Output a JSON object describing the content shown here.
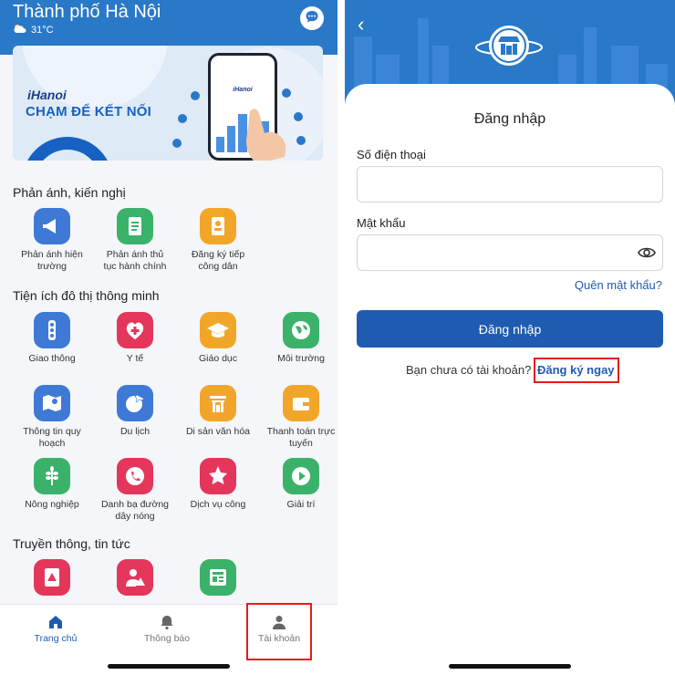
{
  "colors": {
    "brand_blue": "#2a78c8",
    "primary": "#1f5cb0",
    "highlight_red": "#e11d1d",
    "tile_blue": "#3f79d6",
    "tile_green": "#3bb26a",
    "tile_orange": "#f2a629",
    "tile_red": "#e4365b"
  },
  "left": {
    "header": {
      "city": "Thành phố Hà Nội",
      "temperature": "31°C",
      "weather_icon": "cloud-sun-icon",
      "chat_icon": "chat-icon"
    },
    "banner": {
      "brand": "iHanoi",
      "tagline": "CHẠM ĐỂ KẾT NỐI",
      "phone_brand": "iHanoi"
    },
    "sections": {
      "feedback": {
        "title": "Phản ánh, kiến nghị",
        "items": [
          {
            "label_1": "Phản ánh hiện",
            "label_2": "trường",
            "icon": "megaphone-icon",
            "color": "#3f79d6"
          },
          {
            "label_1": "Phản ánh thủ",
            "label_2": "tục hành chính",
            "icon": "document-icon",
            "color": "#3bb26a"
          },
          {
            "label_1": "Đăng ký tiếp",
            "label_2": "công dân",
            "icon": "register-icon",
            "color": "#f2a629"
          }
        ]
      },
      "smart_city": {
        "title": "Tiện ích đô thị thông minh",
        "items": [
          {
            "label_1": "Giao thông",
            "label_2": "",
            "icon": "traffic-light-icon",
            "color": "#3f79d6"
          },
          {
            "label_1": "Y tế",
            "label_2": "",
            "icon": "medical-heart-icon",
            "color": "#e4365b"
          },
          {
            "label_1": "Giáo dục",
            "label_2": "",
            "icon": "graduation-cap-icon",
            "color": "#f2a629"
          },
          {
            "label_1": "Môi trường",
            "label_2": "",
            "icon": "globe-leaf-icon",
            "color": "#3bb26a"
          },
          {
            "label_1": "Thông tin quy",
            "label_2": "hoạch",
            "icon": "map-pin-icon",
            "color": "#3f79d6"
          },
          {
            "label_1": "Du lịch",
            "label_2": "",
            "icon": "globe-plane-icon",
            "color": "#3f79d6"
          },
          {
            "label_1": "Di sản văn hóa",
            "label_2": "",
            "icon": "temple-gate-icon",
            "color": "#f2a629"
          },
          {
            "label_1": "Thanh toán trực",
            "label_2": "tuyến",
            "icon": "wallet-icon",
            "color": "#f2a629"
          },
          {
            "label_1": "Nông nghiệp",
            "label_2": "",
            "icon": "wheat-icon",
            "color": "#3bb26a"
          },
          {
            "label_1": "Danh bạ đường",
            "label_2": "dây nóng",
            "icon": "phone-hotline-icon",
            "color": "#e4365b"
          },
          {
            "label_1": "Dịch vụ công",
            "label_2": "",
            "icon": "star-service-icon",
            "color": "#e4365b"
          },
          {
            "label_1": "Giải trí",
            "label_2": "",
            "icon": "play-icon",
            "color": "#3bb26a"
          }
        ]
      },
      "news": {
        "title": "Truyền thông, tin tức",
        "items": [
          {
            "icon": "warning-document-icon",
            "color": "#e4365b"
          },
          {
            "icon": "warning-person-icon",
            "color": "#e4365b"
          },
          {
            "icon": "newspaper-icon",
            "color": "#3bb26a"
          }
        ]
      }
    },
    "nav": {
      "home": "Trang chủ",
      "notifications": "Thông báo",
      "account": "Tài khoản"
    }
  },
  "right": {
    "title": "Đăng nhập",
    "phone_label": "Số điện thoại",
    "phone_value": "",
    "password_label": "Mật khẩu",
    "password_value": "",
    "forgot": "Quên mật khẩu?",
    "login_button": "Đăng nhập",
    "no_account": "Bạn chưa có tài khoản?",
    "register": "Đăng ký ngay"
  }
}
